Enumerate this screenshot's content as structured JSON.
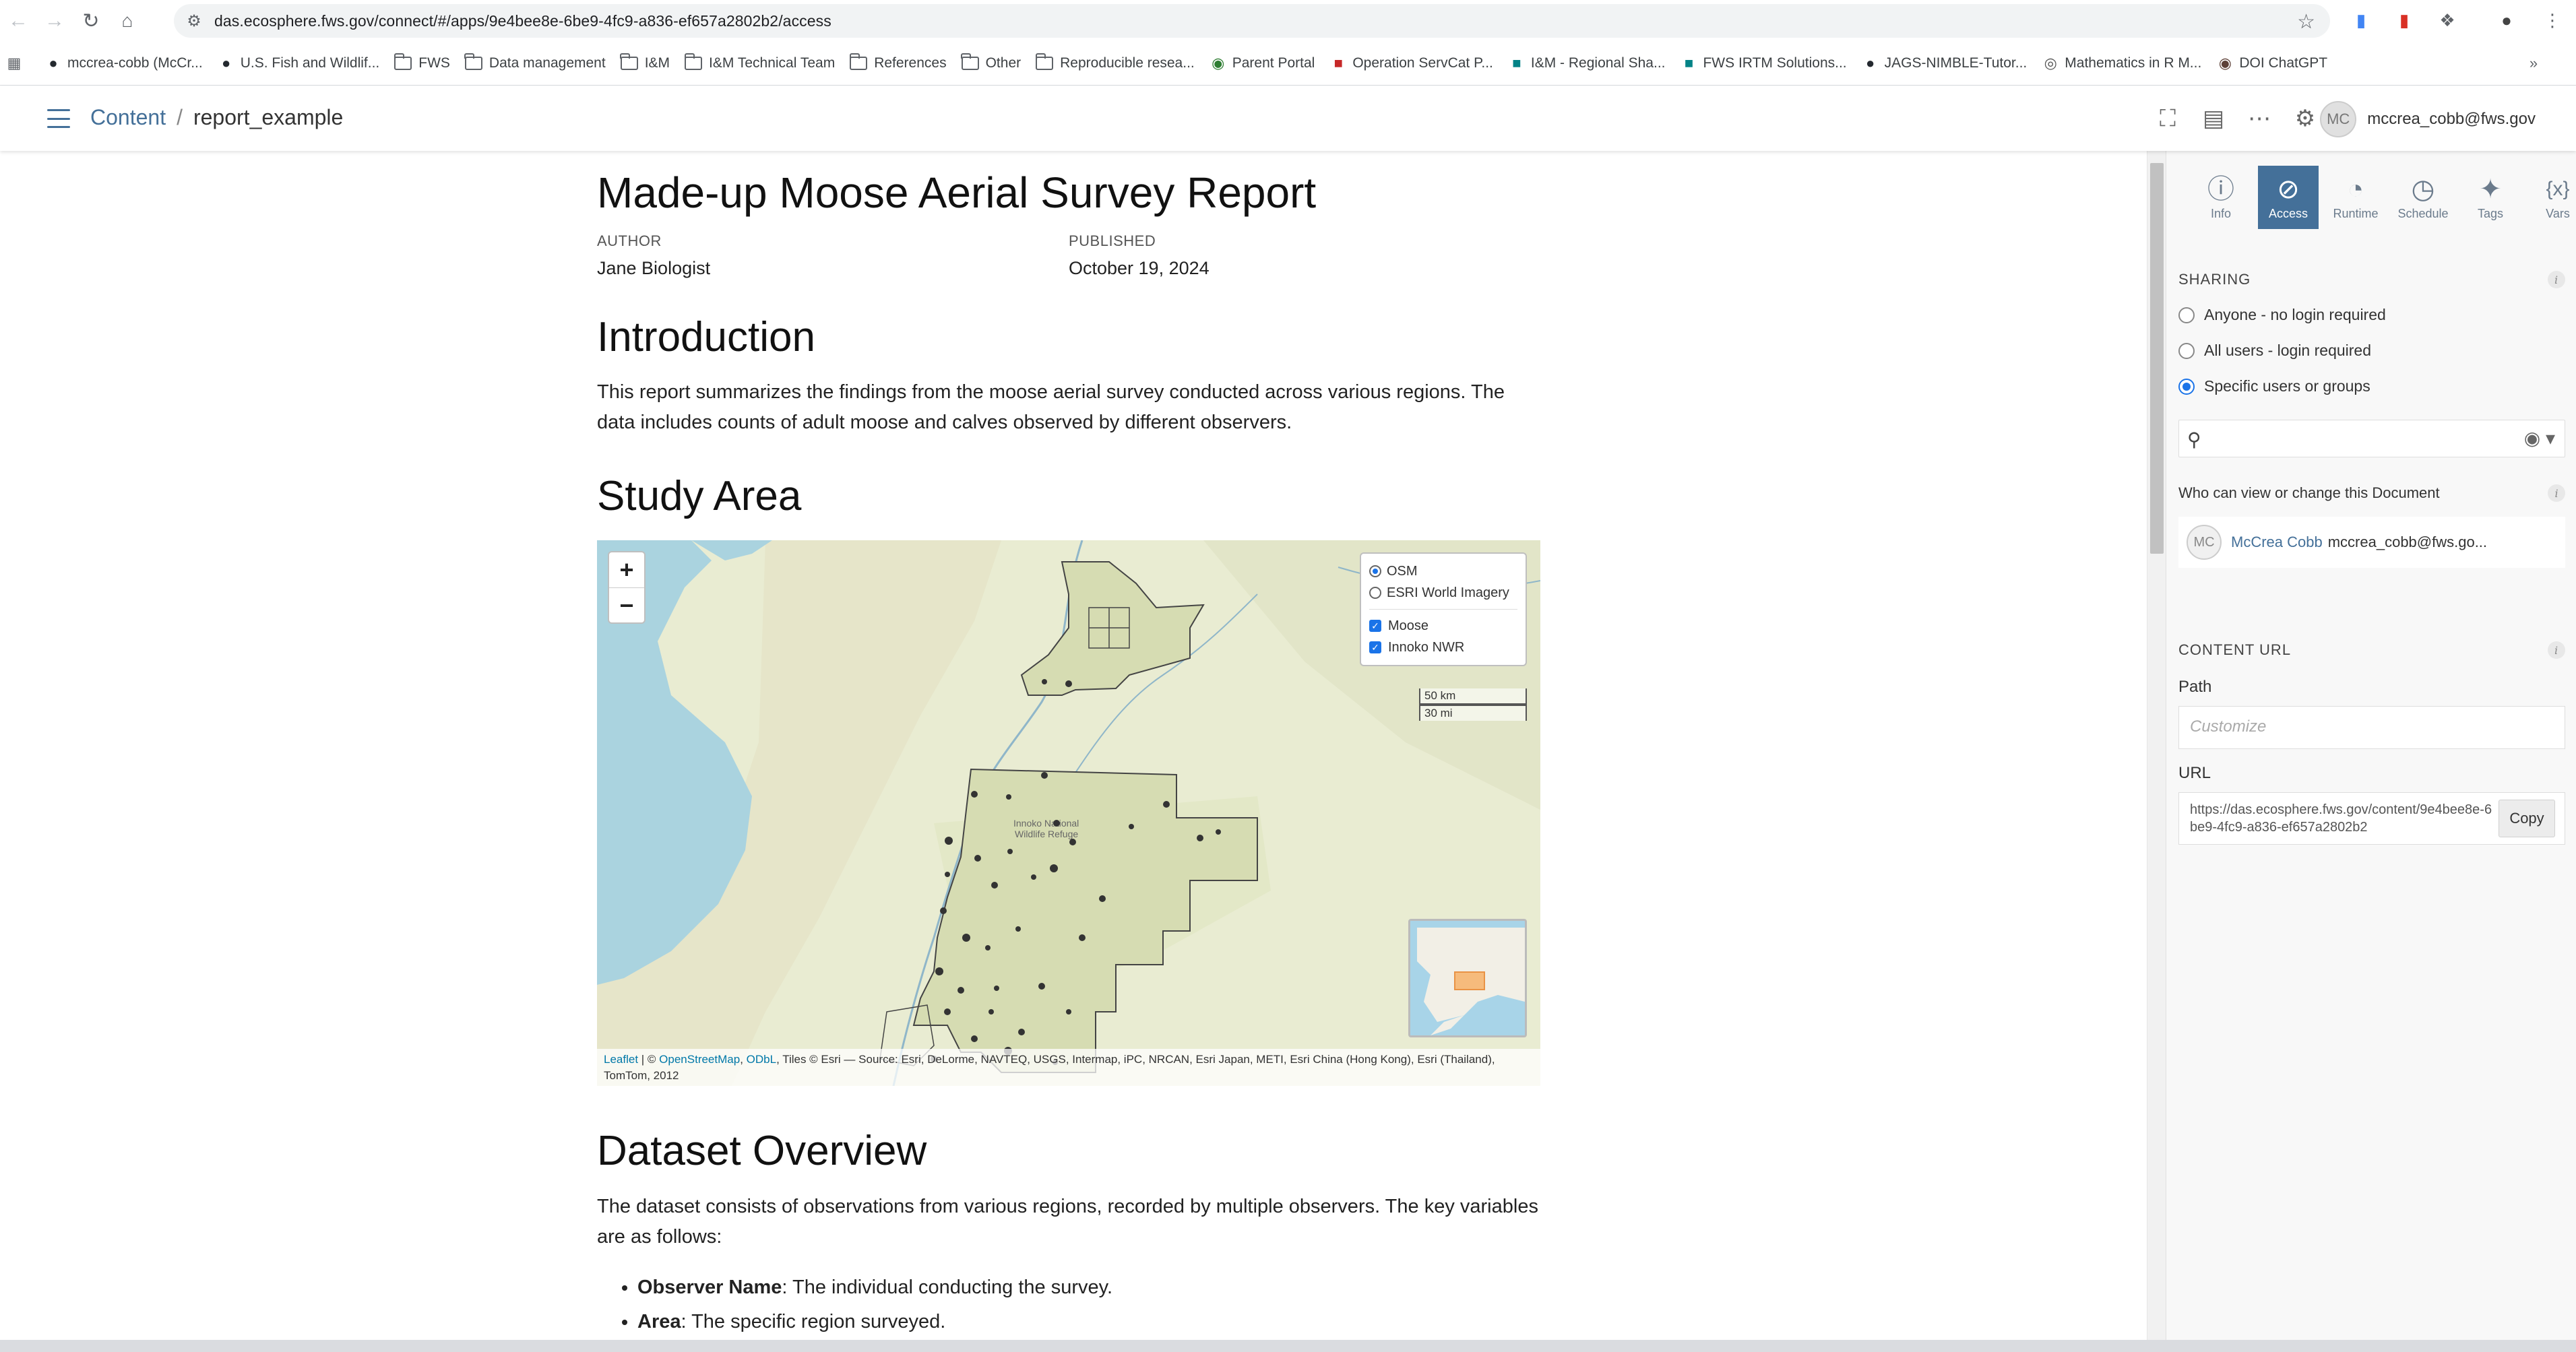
{
  "browser": {
    "url": "das.ecosphere.fws.gov/connect/#/apps/9e4bee8e-6be9-4fc9-a836-ef657a2802b2/access",
    "bookmarks": [
      {
        "label": "mccrea-cobb (McCr...",
        "icon": "github-icon",
        "kind": "site"
      },
      {
        "label": "U.S. Fish and Wildlif...",
        "icon": "github-icon",
        "kind": "site"
      },
      {
        "label": "FWS",
        "icon": "folder-icon",
        "kind": "folder"
      },
      {
        "label": "Data management",
        "icon": "folder-icon",
        "kind": "folder"
      },
      {
        "label": "I&M",
        "icon": "folder-icon",
        "kind": "folder"
      },
      {
        "label": "I&M Technical Team",
        "icon": "folder-icon",
        "kind": "folder"
      },
      {
        "label": "References",
        "icon": "folder-icon",
        "kind": "folder"
      },
      {
        "label": "Other",
        "icon": "folder-icon",
        "kind": "folder"
      },
      {
        "label": "Reproducible resea...",
        "icon": "folder-icon",
        "kind": "folder"
      },
      {
        "label": "Parent Portal",
        "icon": "portal-icon",
        "kind": "site"
      },
      {
        "label": "Operation ServCat P...",
        "icon": "servcat-icon",
        "kind": "site"
      },
      {
        "label": "I&M - Regional Sha...",
        "icon": "sharepoint-icon",
        "kind": "site"
      },
      {
        "label": "FWS IRTM Solutions...",
        "icon": "sharepoint-icon",
        "kind": "site"
      },
      {
        "label": "JAGS-NIMBLE-Tutor...",
        "icon": "github-icon",
        "kind": "site"
      },
      {
        "label": "Mathematics in R M...",
        "icon": "globe-icon",
        "kind": "site"
      },
      {
        "label": "DOI ChatGPT",
        "icon": "chatgpt-icon",
        "kind": "site"
      }
    ]
  },
  "header": {
    "breadcrumb_root": "Content",
    "breadcrumb_sep": "/",
    "breadcrumb_current": "report_example",
    "user_initials": "MC",
    "user_email": "mccrea_cobb@fws.gov"
  },
  "document": {
    "title": "Made-up Moose Aerial Survey Report",
    "author_label": "AUTHOR",
    "author": "Jane Biologist",
    "published_label": "PUBLISHED",
    "published": "October 19, 2024",
    "intro_heading": "Introduction",
    "intro_text": "This report summarizes the findings from the moose aerial survey conducted across various regions. The data includes counts of adult moose and calves observed by different observers.",
    "study_heading": "Study Area",
    "dataset_heading": "Dataset Overview",
    "dataset_text": "The dataset consists of observations from various regions, recorded by multiple observers. The key variables are as follows:",
    "variables": [
      {
        "name": "Observer Name",
        "desc": ": The individual conducting the survey."
      },
      {
        "name": "Area",
        "desc": ": The specific region surveyed."
      }
    ]
  },
  "map": {
    "zoom_in": "+",
    "zoom_out": "−",
    "basemaps": [
      {
        "label": "OSM",
        "selected": true
      },
      {
        "label": "ESRI World Imagery",
        "selected": false
      }
    ],
    "overlays": [
      {
        "label": "Moose",
        "checked": true
      },
      {
        "label": "Innoko NWR",
        "checked": true
      }
    ],
    "scale_km": "50 km",
    "scale_mi": "30 mi",
    "refuge_label_1": "Innoko National",
    "refuge_label_2": "Wildlife Refuge",
    "attribution_leaflet": "Leaflet",
    "attribution_osm": "OpenStreetMap",
    "attribution_odbl": "ODbL",
    "attribution_mid": " | © ",
    "attribution_comma": ", ",
    "attribution_rest": ", Tiles © Esri — Source: Esri, DeLorme, NAVTEQ, USGS, Intermap, iPC, NRCAN, Esri Japan, METI, Esri China (Hong Kong), Esri (Thailand), TomTom, 2012"
  },
  "panel": {
    "tabs": [
      {
        "label": "Info",
        "icon": "info-icon",
        "active": false
      },
      {
        "label": "Access",
        "icon": "lock-icon",
        "active": true
      },
      {
        "label": "Runtime",
        "icon": "gauge-icon",
        "active": false
      },
      {
        "label": "Schedule",
        "icon": "clock-icon",
        "active": false
      },
      {
        "label": "Tags",
        "icon": "tag-icon",
        "active": false
      },
      {
        "label": "Vars",
        "icon": "vars-icon",
        "active": false
      }
    ],
    "sharing_title": "SHARING",
    "sharing_options": [
      {
        "label": "Anyone - no login required",
        "selected": false
      },
      {
        "label": "All users - login required",
        "selected": false
      },
      {
        "label": "Specific users or groups",
        "selected": true
      }
    ],
    "who_label": "Who can view or change this Document",
    "collaborator_initials": "MC",
    "collaborator_name": "McCrea Cobb",
    "collaborator_email": "mccrea_cobb@fws.go...",
    "content_url_title": "CONTENT URL",
    "path_label": "Path",
    "path_placeholder": "Customize",
    "url_label": "URL",
    "url_value": "https://das.ecosphere.fws.gov/content/9e4bee8e-6be9-4fc9-a836-ef657a2802b2",
    "copy_label": "Copy"
  },
  "colors": {
    "accent": "#447099",
    "radio_selected": "#1a73e8",
    "map_land": "#e9ecd2",
    "map_water": "#aad3df",
    "moose_point": "#333333"
  }
}
